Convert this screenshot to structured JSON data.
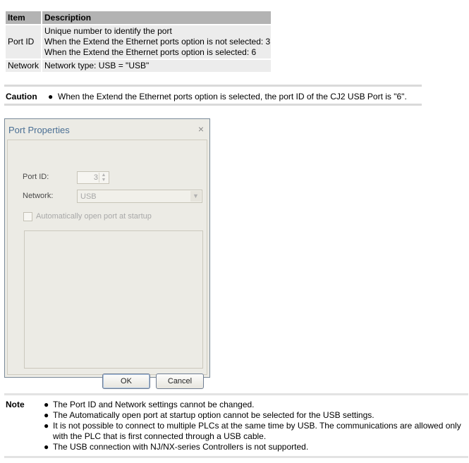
{
  "table": {
    "headers": [
      "Item",
      "Description"
    ],
    "rows": [
      {
        "item": "Port ID",
        "lines": [
          "Unique number to identify the port",
          "When the Extend the Ethernet ports option is not selected: 3",
          "When the Extend the Ethernet ports option is selected: 6"
        ]
      },
      {
        "item": "Network",
        "lines": [
          "Network type: USB = \"USB\""
        ]
      }
    ]
  },
  "caution": {
    "label": "Caution",
    "bullet": "●",
    "text": "When the Extend the Ethernet ports option is selected, the port ID of the CJ2 USB Port is \"6\"."
  },
  "dialog": {
    "title": "Port Properties",
    "close_glyph": "×",
    "port_id_label": "Port ID:",
    "port_id_value": "3",
    "network_label": "Network:",
    "network_value": "USB",
    "auto_open_label": "Automatically open port at startup",
    "auto_open_checked": false,
    "ok_label": "OK",
    "cancel_label": "Cancel"
  },
  "note": {
    "label": "Note",
    "bullet": "●",
    "items": [
      "The Port ID and Network settings cannot be changed.",
      "The Automatically open port at startup option cannot be selected for the USB settings.",
      "It is not possible to connect to multiple PLCs at the same time by USB. The communications are allowed only with the PLC that is first connected through a USB cable.",
      "The USB connection with NJ/NX-series Controllers is not supported."
    ]
  }
}
